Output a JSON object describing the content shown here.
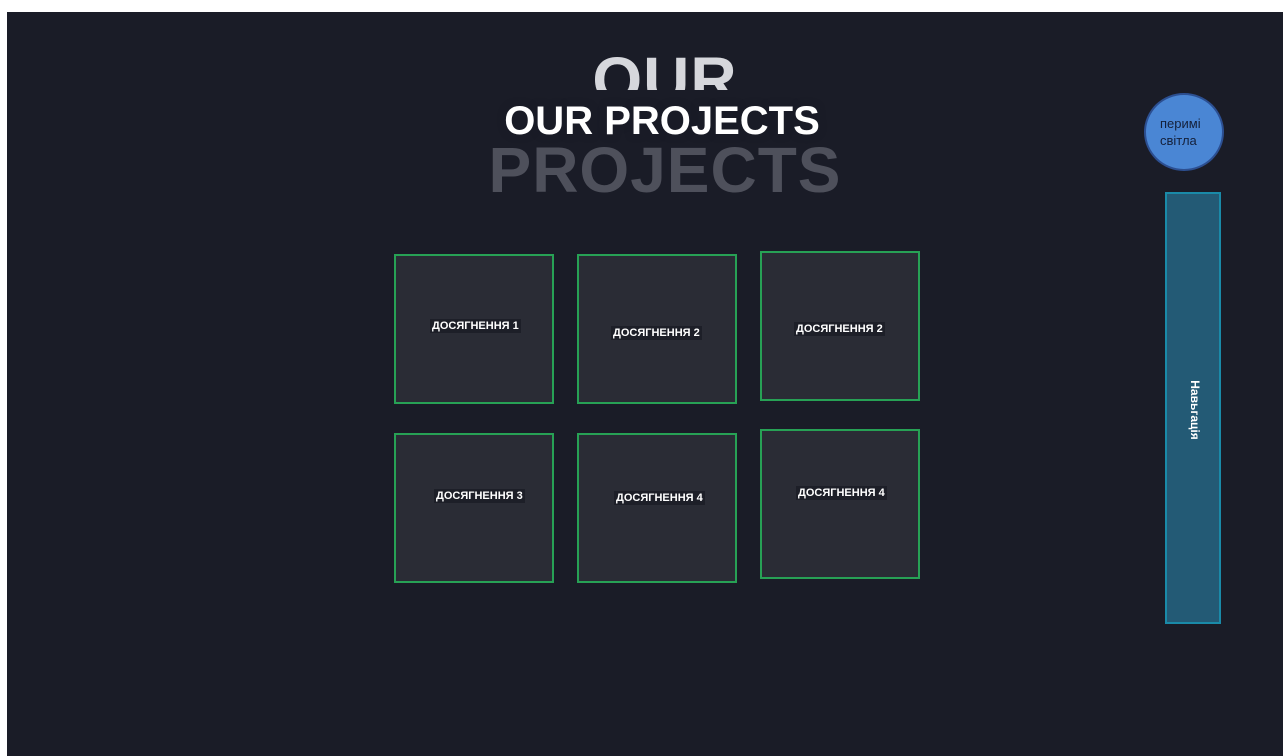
{
  "header": {
    "title": "OUR PROJECTS",
    "bg_line1": "OUR",
    "bg_line2": "PROJECTS"
  },
  "theme_button": {
    "label": "перимі світла"
  },
  "navigation": {
    "label": "Навьгація"
  },
  "cards": [
    {
      "label": "ДОСЯГНЕННЯ 1"
    },
    {
      "label": "ДОСЯГНЕННЯ 2"
    },
    {
      "label": "ДОСЯГНЕННЯ 2"
    },
    {
      "label": "ДОСЯГНЕННЯ 3"
    },
    {
      "label": "ДОСЯГНЕННЯ 4"
    },
    {
      "label": "ДОСЯГНЕННЯ 4"
    }
  ],
  "colors": {
    "background": "#1a1c27",
    "card_background": "#2a2c35",
    "card_border": "#27a155",
    "theme_button": "#4a86d4",
    "nav_bar": "#235a75"
  }
}
